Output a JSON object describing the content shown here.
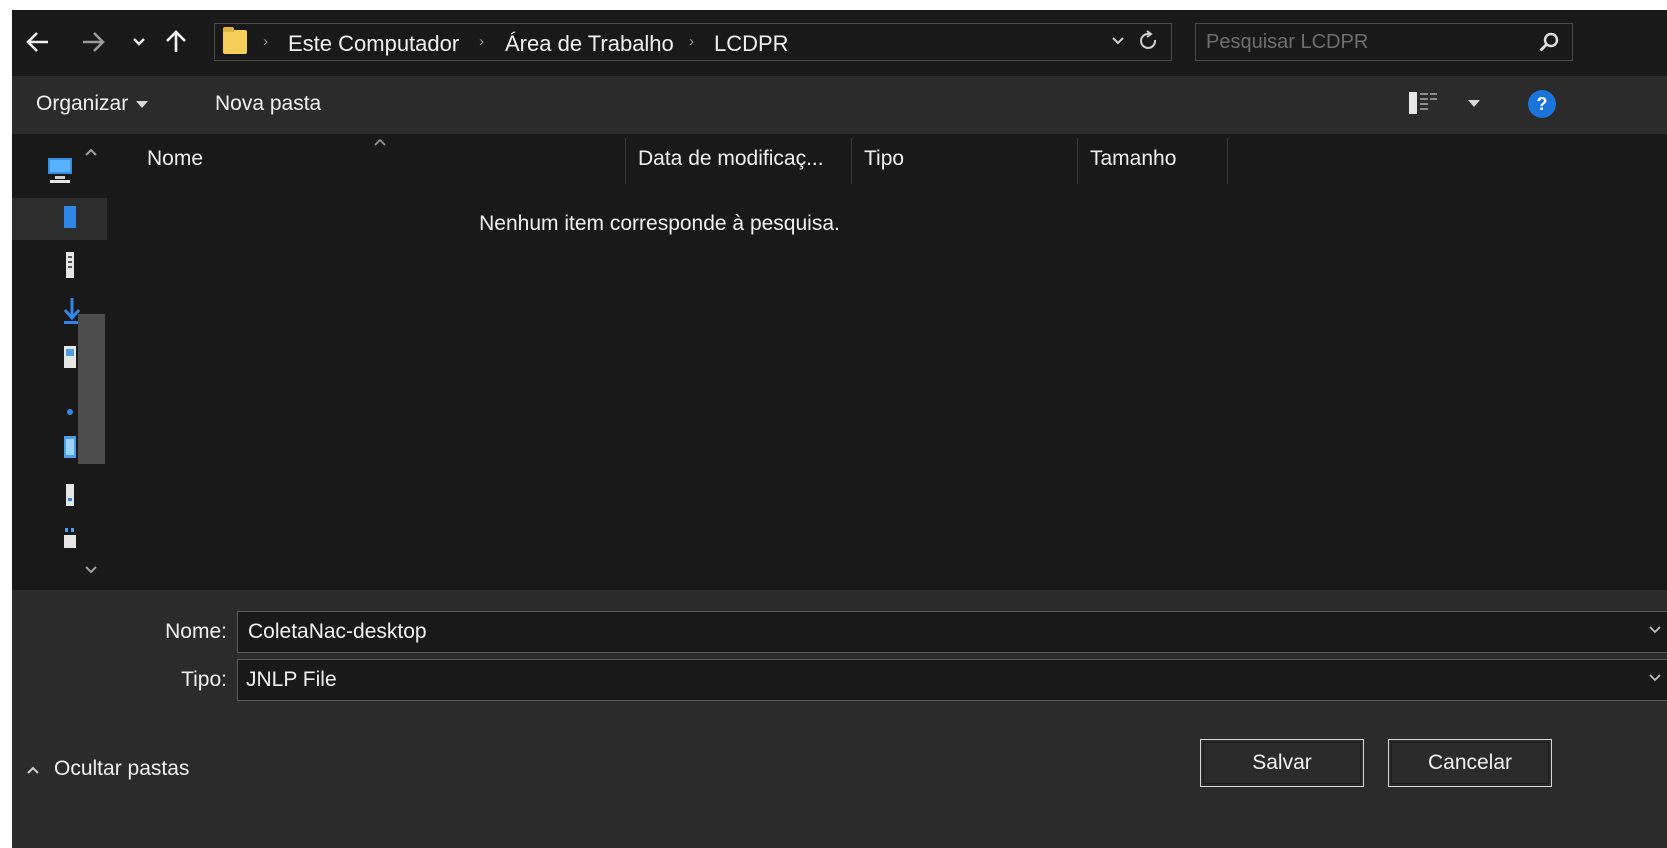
{
  "address": {
    "breadcrumbs": [
      "Este Computador",
      "Área de Trabalho",
      "LCDPR"
    ]
  },
  "search": {
    "placeholder": "Pesquisar LCDPR"
  },
  "toolbar": {
    "organize_label": "Organizar",
    "new_folder_label": "Nova pasta"
  },
  "columns": {
    "name": "Nome",
    "modified": "Data de modificaç...",
    "type": "Tipo",
    "size": "Tamanho"
  },
  "empty_message": "Nenhum item corresponde à pesquisa.",
  "form": {
    "filename_label": "Nome:",
    "filename_value": "ColetaNac-desktop",
    "filetype_label": "Tipo:",
    "filetype_value": "JNLP File"
  },
  "footer": {
    "hide_folders_label": "Ocultar pastas",
    "save_label": "Salvar",
    "cancel_label": "Cancelar"
  },
  "icons": {
    "back": "back-arrow-icon",
    "forward": "forward-arrow-icon",
    "recent": "chevron-down-icon",
    "up": "up-arrow-icon",
    "folder": "folder-icon",
    "refresh": "refresh-icon",
    "search": "search-icon",
    "view": "view-options-icon",
    "help": "help-icon"
  },
  "colors": {
    "background": "#191919",
    "toolbar": "#2b2b2b",
    "accent": "#1b74d9",
    "folder": "#f6cf5b"
  }
}
